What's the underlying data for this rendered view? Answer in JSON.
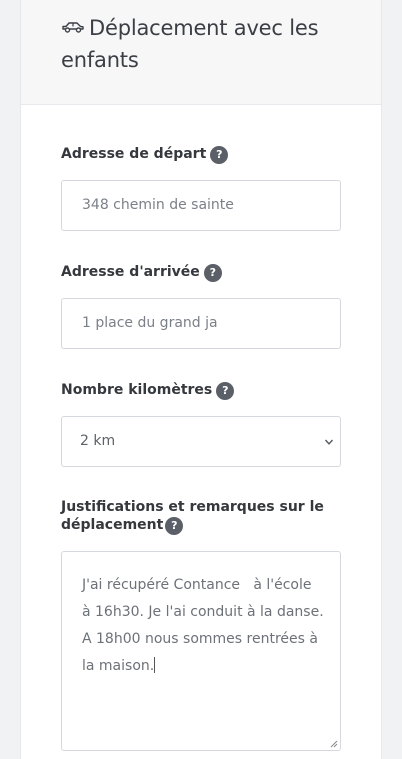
{
  "header": {
    "title": "Déplacement avec les enfants",
    "icon": "car-icon"
  },
  "form": {
    "start_address": {
      "label": "Adresse de départ",
      "help": "?",
      "value": "348 chemin de sainte"
    },
    "end_address": {
      "label": "Adresse d'arrivée",
      "help": "?",
      "value": "1 place du grand ja"
    },
    "distance": {
      "label": "Nombre kilomètres",
      "help": "?",
      "value": "2 km"
    },
    "remarks": {
      "label_line1": "Justifications et remarques sur le",
      "label_line2": "déplacement",
      "help": "?",
      "lines": [
        "J'ai récupéré Contance   à l'école",
        "à 16h30. Je l'ai conduit à la danse.",
        "A 18h00 nous sommes rentrées à",
        "la maison."
      ]
    }
  },
  "colors": {
    "page_bg": "#f1f2f4",
    "card_bg": "#ffffff",
    "header_bg": "#f7f7f8",
    "help_icon_bg": "#5b6068",
    "border": "#d5d8dd"
  }
}
